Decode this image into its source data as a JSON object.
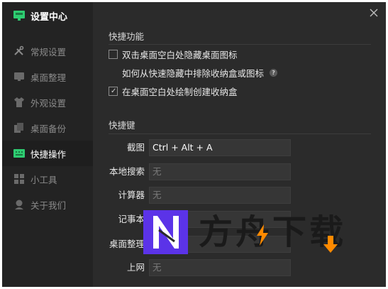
{
  "app": {
    "title": "设置中心",
    "logo_icon": "monitor-icon",
    "accent": "#2ecc71"
  },
  "sidebar": {
    "items": [
      {
        "label": "常规设置",
        "icon": "tools-icon",
        "active": false
      },
      {
        "label": "桌面整理",
        "icon": "monitor-icon",
        "active": false
      },
      {
        "label": "外观设置",
        "icon": "shirt-icon",
        "active": false
      },
      {
        "label": "桌面备份",
        "icon": "backup-icon",
        "active": false
      },
      {
        "label": "快捷操作",
        "icon": "keyboard-icon",
        "active": true
      },
      {
        "label": "小工具",
        "icon": "grid-icon",
        "active": false
      },
      {
        "label": "关于我们",
        "icon": "user-icon",
        "active": false
      }
    ]
  },
  "quick_functions": {
    "title": "快捷功能",
    "option1": {
      "label": "双击桌面空白处隐藏桌面图标",
      "checked": false
    },
    "help_link": "如何从快速隐藏中排除收纳盒或图标",
    "help_icon": "?",
    "option2": {
      "label": "在桌面空白处绘制创建收纳盒",
      "checked": true,
      "check": "✓"
    }
  },
  "hotkeys": {
    "title": "快捷键",
    "rows": [
      {
        "label": "截图",
        "value": "Ctrl + Alt + A"
      },
      {
        "label": "本地搜索",
        "value": "无"
      },
      {
        "label": "计算器",
        "value": "无"
      },
      {
        "label": "记事本",
        "value": ""
      },
      {
        "label": "桌面整理",
        "value": ""
      },
      {
        "label": "上网",
        "value": "无"
      }
    ]
  },
  "watermark": {
    "text": "方舟下载"
  }
}
